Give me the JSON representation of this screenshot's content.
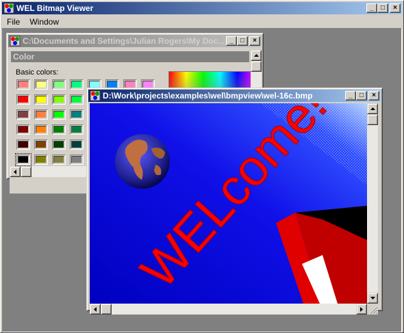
{
  "app": {
    "title": "WEL Bitmap Viewer",
    "menu": [
      "File",
      "Window"
    ]
  },
  "color_window": {
    "title": "C:\\Documents and Settings\\Julian Rogers\\My Doc...",
    "dialog_caption": "Color",
    "basic_colors_label": "Basic colors:",
    "basic_colors": [
      "#ff8080",
      "#ffff80",
      "#80ff80",
      "#00ff80",
      "#80ffff",
      "#0080ff",
      "#ff80c0",
      "#ff80ff",
      "#ff0000",
      "#ffff00",
      "#80ff00",
      "#00ff40",
      "#00ffff",
      "#0080c0",
      "#8080c0",
      "#ff00ff",
      "#804040",
      "#ff8040",
      "#00ff00",
      "#008080",
      "#004080",
      "#8080ff",
      "#800040",
      "#ff0080",
      "#800000",
      "#ff8000",
      "#008000",
      "#008040",
      "#0000ff",
      "#0000a0",
      "#800080",
      "#8000ff",
      "#400000",
      "#804000",
      "#004000",
      "#004040",
      "#000080",
      "#000040",
      "#400040",
      "#400080",
      "#000000",
      "#808000",
      "#808040",
      "#808080",
      "#408080",
      "#c0c0c0",
      "#400040",
      "#ffffff"
    ],
    "selected_color_index": 40
  },
  "bitmap_window": {
    "title": "D:\\Work\\projects\\examples\\wel\\bmpview\\wel-16c.bmp",
    "image_text": "WELcome!",
    "colors": {
      "background": "#1010e0",
      "text": "#ff0000",
      "book": "#c00000"
    }
  },
  "icons": {
    "app": "wel-app-icon",
    "minimize": "minimize-icon",
    "maximize": "maximize-icon",
    "close": "close-icon",
    "scroll_up": "arrow-up-icon",
    "scroll_down": "arrow-down-icon",
    "scroll_left": "arrow-left-icon",
    "scroll_right": "arrow-right-icon",
    "size_grip": "size-grip-icon"
  },
  "title_button_glyphs": {
    "minimize": "_",
    "maximize": "□",
    "close": "×"
  }
}
